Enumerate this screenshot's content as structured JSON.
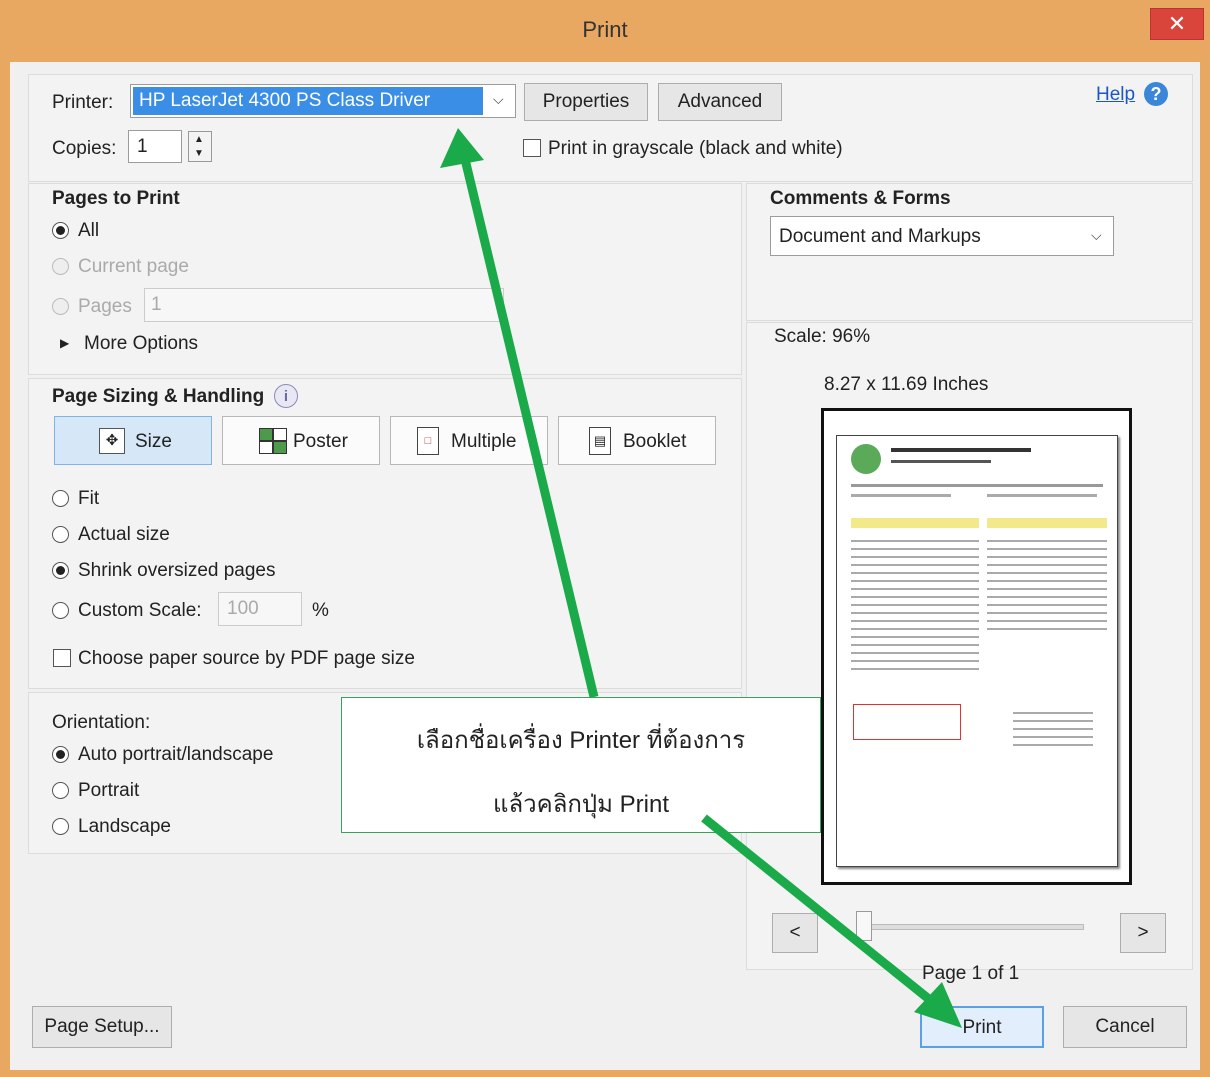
{
  "window": {
    "title": "Print",
    "close_glyph": "✕"
  },
  "printer": {
    "label": "Printer:",
    "selected": "HP LaserJet 4300 PS Class Driver",
    "properties_label": "Properties",
    "advanced_label": "Advanced",
    "help_label": "Help",
    "copies_label": "Copies:",
    "copies_value": "1",
    "grayscale_label": "Print in grayscale (black and white)"
  },
  "pages_to_print": {
    "title": "Pages to Print",
    "all": "All",
    "current": "Current page",
    "pages": "Pages",
    "pages_value": "1",
    "more_options": "More Options"
  },
  "sizing": {
    "title": "Page Sizing & Handling",
    "size": "Size",
    "poster": "Poster",
    "multiple": "Multiple",
    "booklet": "Booklet",
    "fit": "Fit",
    "actual": "Actual size",
    "shrink": "Shrink oversized pages",
    "custom": "Custom Scale:",
    "custom_value": "100",
    "percent": "%",
    "paper_source": "Choose paper source by PDF page size"
  },
  "orientation": {
    "title": "Orientation:",
    "auto": "Auto portrait/landscape",
    "portrait": "Portrait",
    "landscape": "Landscape"
  },
  "comments": {
    "title": "Comments & Forms",
    "selected": "Document and Markups"
  },
  "preview": {
    "scale": "Scale:  96%",
    "dimensions": "8.27 x 11.69 Inches",
    "prev": "<",
    "next": ">",
    "page_info": "Page 1 of 1",
    "slider_position": 0
  },
  "callout": {
    "line1": "เลือกชื่อเครื่อง Printer ที่ต้องการ",
    "line2": "แล้วคลิกปุ่ม Print"
  },
  "footer": {
    "page_setup": "Page Setup...",
    "print": "Print",
    "cancel": "Cancel"
  },
  "colors": {
    "arrow": "#1aaa4a",
    "printer_highlight": "#3a8ee6",
    "title_bar": "#e8a862",
    "close": "#d9453a"
  }
}
